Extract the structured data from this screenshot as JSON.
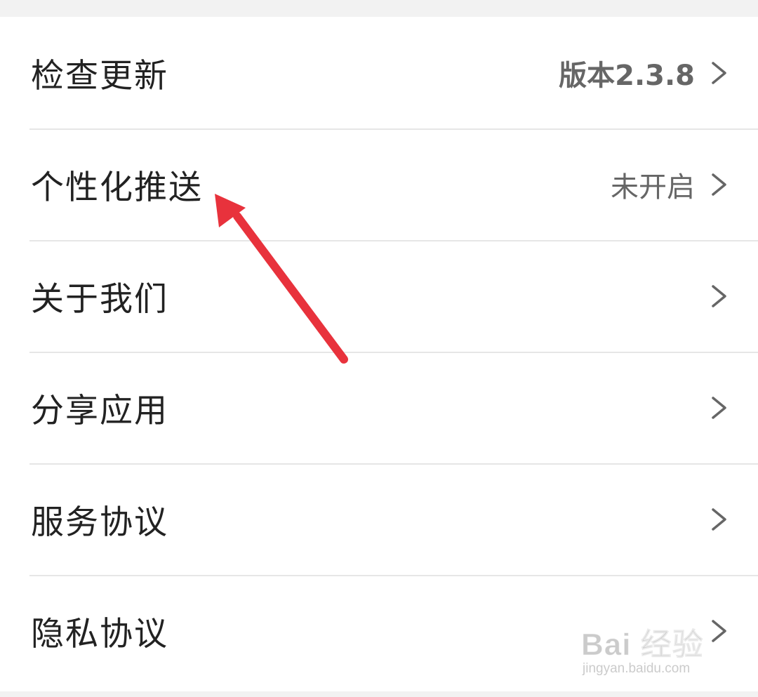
{
  "settings": {
    "items": [
      {
        "label": "检查更新",
        "value": "版本2.3.8"
      },
      {
        "label": "个性化推送",
        "value": "未开启"
      },
      {
        "label": "关于我们",
        "value": ""
      },
      {
        "label": "分享应用",
        "value": ""
      },
      {
        "label": "服务协议",
        "value": ""
      },
      {
        "label": "隐私协议",
        "value": ""
      }
    ]
  },
  "icons": {
    "chevron": "chevron-right-icon"
  },
  "annotation": {
    "arrow_color": "#e8323c"
  },
  "watermark": {
    "brand": "Bai 经验",
    "url": "jingyan.baidu.com"
  },
  "colors": {
    "background": "#f2f2f2",
    "card": "#ffffff",
    "label": "#222222",
    "value": "#666666",
    "divider": "#e6e6e6"
  }
}
